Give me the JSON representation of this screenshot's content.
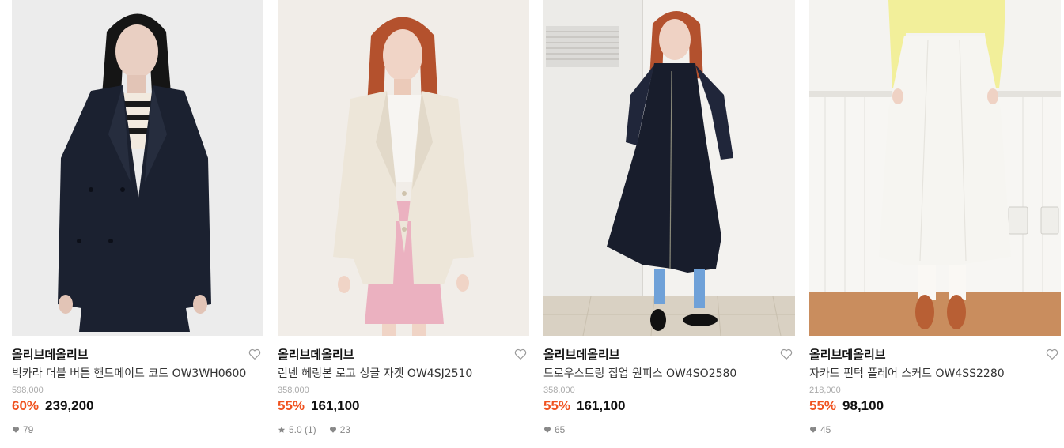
{
  "products": [
    {
      "brand": "올리브데올리브",
      "name": "빅카라 더블 버튼 핸드메이드 코트 OW3WH0600",
      "original_price": "598,000",
      "discount": "60%",
      "price": "239,200",
      "likes": "79"
    },
    {
      "brand": "올리브데올리브",
      "name": "린넨 헤링본 로고 싱글 자켓 OW4SJ2510",
      "original_price": "358,000",
      "discount": "55%",
      "price": "161,100",
      "rating": "5.0 (1)",
      "likes": "23"
    },
    {
      "brand": "올리브데올리브",
      "name": "드로우스트링 집업 원피스 OW4SO2580",
      "original_price": "358,000",
      "discount": "55%",
      "price": "161,100",
      "likes": "65"
    },
    {
      "brand": "올리브데올리브",
      "name": "자카드 핀턱 플레어 스커트 OW4SS2280",
      "original_price": "218,000",
      "discount": "55%",
      "price": "98,100",
      "likes": "45"
    }
  ],
  "colors": {
    "discount": "#f0521f",
    "original_price": "#aaaaaa",
    "meta": "#888888"
  },
  "icons": {
    "wishlist": "heart-outline-icon",
    "like_count": "heart-filled-icon",
    "rating": "star-icon"
  }
}
